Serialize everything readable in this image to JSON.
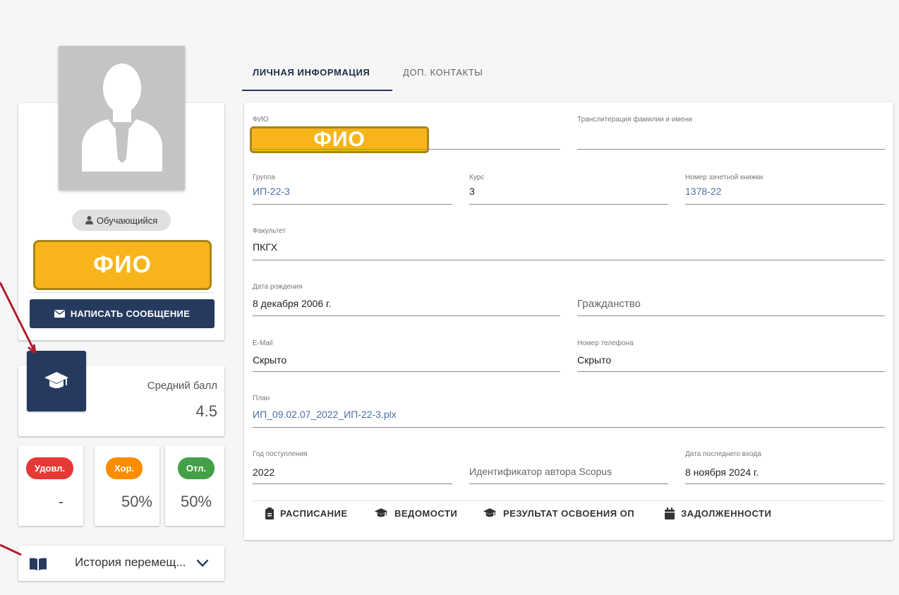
{
  "profile": {
    "role": "Обучающийся",
    "name_placeholder": "ФИО",
    "message_button": "НАПИСАТЬ СООБЩЕНИЕ"
  },
  "average": {
    "label": "Средний балл",
    "value": "4.5"
  },
  "grades": [
    {
      "label": "Удовл.",
      "value": "-",
      "color": "#e53935"
    },
    {
      "label": "Хор.",
      "value": "50%",
      "color": "#fb8c00"
    },
    {
      "label": "Отл.",
      "value": "50%",
      "color": "#43a047"
    }
  ],
  "history": {
    "label": "История перемещ..."
  },
  "tabs": [
    {
      "label": "ЛИЧНАЯ ИНФОРМАЦИЯ",
      "active": true
    },
    {
      "label": "ДОП. КОНТАКТЫ",
      "active": false
    }
  ],
  "form": {
    "fio_label": "ФИО",
    "fio_value": "ФИО",
    "translit_label": "Транслитерация фамилии и имени",
    "group_label": "Группа",
    "group_value": "ИП-22-3",
    "course_label": "Курс",
    "course_value": "3",
    "record_book_label": "Номер зачетной книжки",
    "record_book_value": "1378-22",
    "faculty_label": "Факультет",
    "faculty_value": "ПКГХ",
    "birth_label": "Дата рождения",
    "birth_value": "8 декабря 2006 г.",
    "citizenship_placeholder": "Гражданство",
    "email_label": "E-Mail",
    "email_value": "Скрыто",
    "phone_label": "Номер телефона",
    "phone_value": "Скрыто",
    "plan_label": "План",
    "plan_value": "ИП_09.02.07_2022_ИП-22-3.plx",
    "admission_label": "Год поступления",
    "admission_value": "2022",
    "scopus_placeholder": "Идентификатор автора Scopus",
    "last_login_label": "Дата последнего входа",
    "last_login_value": "8 ноября 2024 г."
  },
  "actions": {
    "schedule": "РАСПИСАНИЕ",
    "statements": "ВЕДОМОСТИ",
    "results": "РЕЗУЛЬТАТ ОСВОЕНИЯ ОП",
    "debts": "ЗАДОЛЖЕННОСТИ"
  },
  "colors": {
    "primary": "#253a5e",
    "highlight": "#f8b51b",
    "link": "#4a6fa5",
    "annotation": "#b01c2e"
  }
}
